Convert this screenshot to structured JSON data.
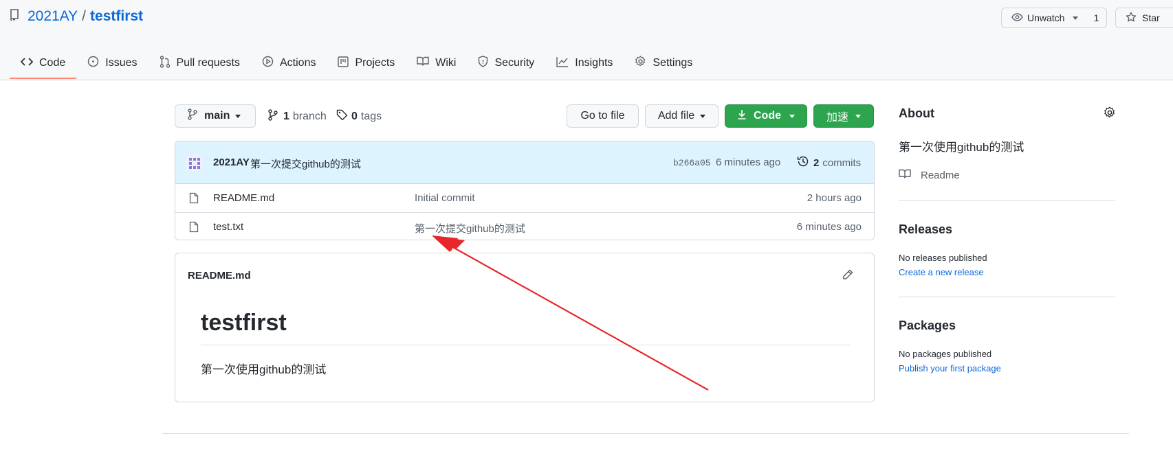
{
  "repo": {
    "owner": "2021AY",
    "separator": "/",
    "name": "testfirst"
  },
  "header_buttons": {
    "watch_label": "Unwatch",
    "watch_count": "1",
    "star_label": "Star"
  },
  "tabs": [
    {
      "label": "Code",
      "icon": "code-icon"
    },
    {
      "label": "Issues",
      "icon": "issue-icon"
    },
    {
      "label": "Pull requests",
      "icon": "pull-request-icon"
    },
    {
      "label": "Actions",
      "icon": "play-icon"
    },
    {
      "label": "Projects",
      "icon": "project-icon"
    },
    {
      "label": "Wiki",
      "icon": "book-icon"
    },
    {
      "label": "Security",
      "icon": "shield-icon"
    },
    {
      "label": "Insights",
      "icon": "graph-icon"
    },
    {
      "label": "Settings",
      "icon": "gear-icon"
    }
  ],
  "toolbar": {
    "branch": "main",
    "branch_count": "1",
    "branch_word": "branch",
    "tag_count": "0",
    "tag_word": "tags",
    "go_to_file": "Go to file",
    "add_file": "Add file",
    "code": "Code",
    "accelerate": "加速"
  },
  "latest_commit": {
    "author": "2021AY",
    "message": "第一次提交github的测试",
    "sha": "b266a05",
    "time": "6 minutes ago",
    "commit_count": "2",
    "commit_word": "commits"
  },
  "files": [
    {
      "name": "README.md",
      "message": "Initial commit",
      "time": "2 hours ago"
    },
    {
      "name": "test.txt",
      "message": "第一次提交github的测试",
      "time": "6 minutes ago"
    }
  ],
  "readme": {
    "filename": "README.md",
    "heading": "testfirst",
    "body": "第一次使用github的测试"
  },
  "about": {
    "title": "About",
    "description": "第一次使用github的测试",
    "readme_link": "Readme"
  },
  "releases": {
    "title": "Releases",
    "empty_text": "No releases published",
    "create_link": "Create a new release"
  },
  "packages": {
    "title": "Packages",
    "empty_text": "No packages published",
    "publish_link": "Publish your first package"
  },
  "colors": {
    "link": "#0969da",
    "green": "#2da44e",
    "commit_bg": "#ddf4ff",
    "tab_underline": "#fd8c73",
    "arrow": "#e8262b"
  }
}
